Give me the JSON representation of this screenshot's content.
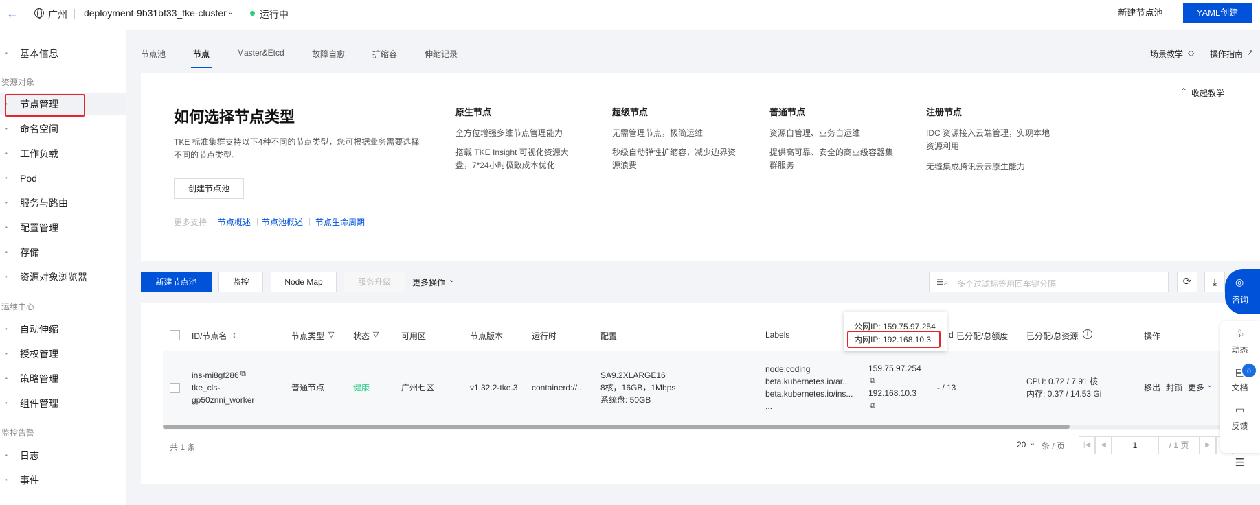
{
  "topbar": {
    "region": "广州",
    "cluster": "deployment-9b31bf33_tke-cluster",
    "status": "运行中",
    "btn_new_pool": "新建节点池",
    "btn_yaml": "YAML创建"
  },
  "sidebar": {
    "items": [
      "基本信息",
      "节点管理",
      "命名空间",
      "工作负载",
      "Pod",
      "服务与路由",
      "配置管理",
      "存储",
      "资源对象浏览器",
      "自动伸缩",
      "授权管理",
      "策略管理",
      "组件管理",
      "日志",
      "事件"
    ],
    "groups": [
      "资源对象",
      "运维中心",
      "监控告警"
    ]
  },
  "tabs": [
    "节点池",
    "节点",
    "Master&Etcd",
    "故障自愈",
    "扩缩容",
    "伸缩记录"
  ],
  "tab_links": {
    "scene": "场景教学",
    "guide": "操作指南"
  },
  "intro": {
    "title": "如何选择节点类型",
    "desc": "TKE 标准集群支持以下4种不同的节点类型，您可根据业务需要选择不同的节点类型。",
    "create_btn": "创建节点池",
    "more_label": "更多支持",
    "links": [
      "节点概述",
      "节点池概述",
      "节点生命周期"
    ],
    "collapse": "收起教学",
    "columns": [
      {
        "title": "原生节点",
        "lines": [
          "全方位增强多维节点管理能力",
          "搭载 TKE Insight 可视化资源大盘，7*24小时极致成本优化"
        ]
      },
      {
        "title": "超级节点",
        "lines": [
          "无需管理节点，极简运维",
          "秒级自动弹性扩缩容，减少边界资源浪费"
        ]
      },
      {
        "title": "普通节点",
        "lines": [
          "资源自管理、业务自运维",
          "提供高可靠、安全的商业级容器集群服务"
        ]
      },
      {
        "title": "注册节点",
        "lines": [
          "IDC 资源接入云端管理，实现本地资源利用",
          "无缝集成腾讯云云原生能力"
        ]
      }
    ]
  },
  "toolbar": {
    "new_pool": "新建节点池",
    "monitor": "监控",
    "node_map": "Node Map",
    "upgrade": "服务升级",
    "more_ops": "更多操作",
    "search_placeholder": "多个过滤标签用回车键分隔"
  },
  "table": {
    "headers": {
      "id": "ID/节点名",
      "type": "节点类型",
      "status": "状态",
      "zone": "可用区",
      "version": "节点版本",
      "runtime": "运行时",
      "config": "配置",
      "labels": "Labels",
      "ip_partial": "d",
      "alloc_quota": "已分配/总额度",
      "alloc_res": "已分配/总资源",
      "ops": "操作"
    },
    "row": {
      "id": "ins-mi8gf286",
      "name": "tke_cls-gp50znni_worker",
      "type": "普通节点",
      "status": "健康",
      "zone": "广州七区",
      "version": "v1.32.2-tke.3",
      "runtime": "containerd://...",
      "config": [
        "SA9.2XLARGE16",
        "8核，16GB，1Mbps",
        "系统盘: 50GB"
      ],
      "labels": [
        "node:coding",
        "beta.kubernetes.io/ar...",
        "beta.kubernetes.io/ins...",
        "..."
      ],
      "public_ip": "159.75.97.254",
      "private_ip": "192.168.10.3",
      "quota": "- / 13",
      "cpu": "CPU: 0.72 / 7.91 核",
      "mem": "内存: 0.37 / 14.53 Gi",
      "op_remove": "移出",
      "op_lock": "封锁",
      "op_more": "更多"
    },
    "tooltip_public": "公网IP: 159.75.97.254",
    "tooltip_private": "内网IP: 192.168.10.3",
    "total": "共 1 条",
    "page_size": "20",
    "per_page": "条 / 页",
    "page": "1",
    "page_total": "/ 1 页"
  },
  "float": {
    "consult": "咨询",
    "dynamic": "动态",
    "doc": "文档",
    "feedback": "反馈"
  },
  "colors": {
    "primary": "#0052d9",
    "healthy": "#29cc85",
    "highlight": "#e5242b"
  }
}
